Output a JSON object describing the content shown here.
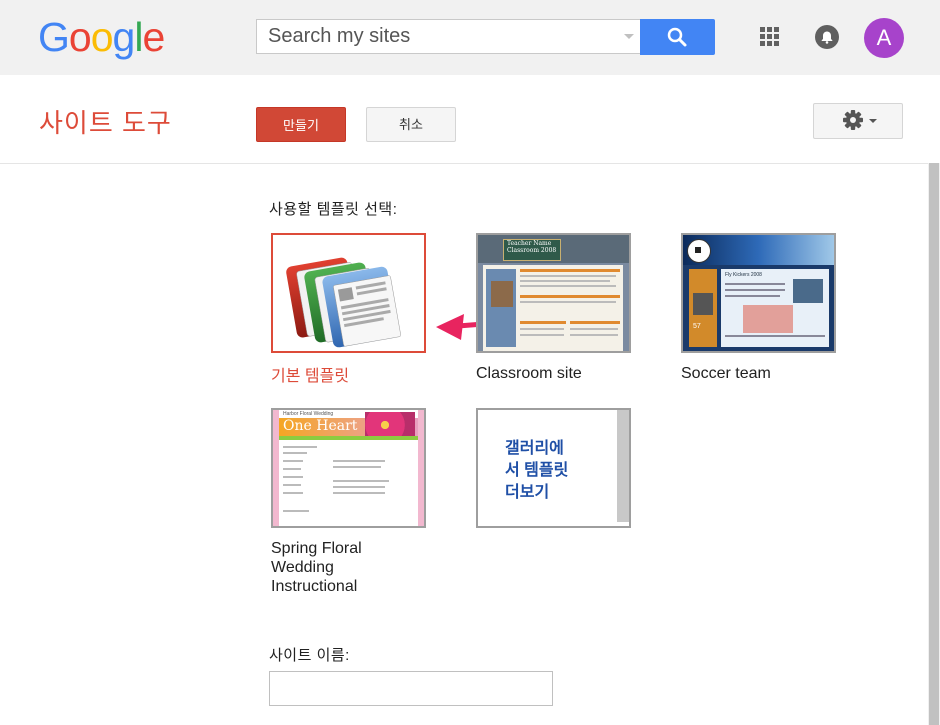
{
  "header": {
    "logo_letters": [
      {
        "ch": "G",
        "color": "#4285F4"
      },
      {
        "ch": "o",
        "color": "#EA4335"
      },
      {
        "ch": "o",
        "color": "#FBBC05"
      },
      {
        "ch": "g",
        "color": "#4285F4"
      },
      {
        "ch": "l",
        "color": "#34A853"
      },
      {
        "ch": "e",
        "color": "#EA4335"
      }
    ],
    "search_placeholder": "Search my sites",
    "avatar_initial": "A"
  },
  "toolbar": {
    "title": "사이트 도구",
    "create_label": "만들기",
    "cancel_label": "취소"
  },
  "main": {
    "template_prompt": "사용할 템플릿 선택:",
    "templates": [
      {
        "name": "기본 템플릿",
        "selected": true
      },
      {
        "name": "Classroom site",
        "thumb_text": [
          "Teacher Name",
          "Classroom 2008"
        ]
      },
      {
        "name": "Soccer team",
        "thumb_text": [
          "Fly Kickers 2008",
          "57"
        ]
      },
      {
        "name_lines": [
          "Spring Floral",
          "Wedding",
          "Instructional"
        ],
        "thumb_text": [
          "Harbor Floral Wedding",
          "One Heart"
        ]
      }
    ],
    "gallery_link": [
      "갤러리에",
      "서 템플릿",
      "더보기"
    ],
    "site_name_label": "사이트 이름:"
  },
  "colors": {
    "accent_red": "#dd4b39",
    "create_button": "#d14836",
    "search_blue": "#4285f4",
    "gallery_text": "#1f4fa6",
    "avatar": "#a743cb"
  },
  "icons": [
    "search-icon",
    "apps-icon",
    "notifications-icon",
    "gear-icon",
    "chevron-down-icon",
    "arrow-icon"
  ]
}
